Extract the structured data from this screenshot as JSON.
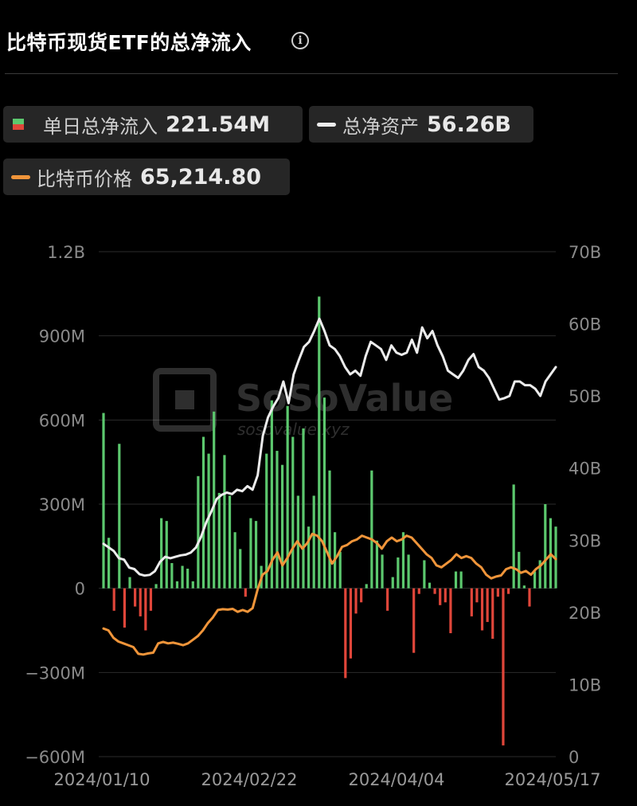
{
  "header": {
    "title": "比特币现货ETF的总净流入",
    "info_icon": "info-icon"
  },
  "legend": {
    "daily_inflow": {
      "label": "单日总净流入",
      "value": "221.54M",
      "pos_color": "#5cc86e",
      "neg_color": "#e0463a"
    },
    "total_assets": {
      "label": "总净资产",
      "value": "56.26B",
      "color": "#ececec"
    },
    "btc_price": {
      "label": "比特币价格",
      "value": "65,214.80",
      "color": "#f0953a"
    }
  },
  "watermark": {
    "brand": "SoSoValue",
    "url": "sosovalue.xyz"
  },
  "chart_data": {
    "type": "bar",
    "left_axis": {
      "ticks": [
        "1.2B",
        "900M",
        "600M",
        "300M",
        "0",
        "−300M",
        "−600M"
      ],
      "ylim": [
        -600,
        1200
      ],
      "unit": "M"
    },
    "right_axis": {
      "ticks": [
        "70B",
        "60B",
        "50B",
        "40B",
        "30B",
        "20B",
        "10B",
        "0"
      ],
      "ylim": [
        0,
        70
      ],
      "unit": "B"
    },
    "x_ticks": [
      "2024/01/10",
      "2024/02/22",
      "2024/04/04",
      "2024/05/17"
    ],
    "series": [
      {
        "name": "单日总净流入",
        "type": "bar",
        "values": [
          625,
          180,
          -80,
          515,
          -140,
          40,
          -65,
          -100,
          -150,
          -80,
          15,
          250,
          240,
          90,
          25,
          80,
          70,
          25,
          400,
          540,
          480,
          630,
          340,
          475,
          330,
          200,
          140,
          -30,
          250,
          240,
          80,
          480,
          670,
          490,
          440,
          650,
          540,
          330,
          570,
          220,
          330,
          1040,
          680,
          420,
          200,
          130,
          -320,
          -250,
          -90,
          -50,
          15,
          420,
          170,
          120,
          -80,
          40,
          110,
          200,
          120,
          -230,
          -20,
          100,
          20,
          -20,
          -60,
          -50,
          -160,
          60,
          60,
          0,
          -100,
          -50,
          -150,
          -120,
          -180,
          -30,
          -560,
          -20,
          370,
          130,
          10,
          -65,
          60,
          100,
          300,
          250,
          220
        ]
      },
      {
        "name": "总净资产",
        "type": "line",
        "values": [
          29.5,
          29.0,
          28.5,
          27.5,
          27.3,
          26.2,
          26.0,
          25.3,
          25.1,
          25.2,
          25.7,
          27.0,
          27.7,
          27.5,
          27.7,
          27.9,
          28.0,
          28.3,
          29.0,
          30.5,
          32.5,
          34.0,
          35.7,
          36.3,
          36.6,
          36.4,
          37.0,
          36.8,
          37.5,
          37.0,
          39.0,
          44.5,
          47.0,
          48.5,
          49.7,
          52.0,
          49.0,
          53.0,
          55.0,
          56.8,
          57.5,
          59.0,
          60.7,
          59.0,
          57.0,
          56.5,
          55.5,
          54.0,
          53.0,
          53.5,
          52.8,
          55.5,
          57.5,
          57.0,
          56.5,
          55.0,
          57.0,
          56.0,
          55.7,
          56.0,
          57.8,
          56.0,
          59.5,
          58.0,
          59.0,
          57.0,
          55.5,
          53.5,
          53.0,
          52.5,
          53.5,
          55.0,
          55.8,
          54.0,
          53.5,
          52.5,
          51.0,
          49.5,
          49.7,
          50.0,
          52.0,
          52.0,
          51.5,
          51.5,
          51.0,
          50.0,
          52.0,
          53.0,
          54.0
        ]
      },
      {
        "name": "比特币价格",
        "type": "line",
        "values": [
          46500,
          46000,
          44000,
          43000,
          42500,
          42000,
          41500,
          39700,
          39500,
          39800,
          40000,
          42500,
          42900,
          42500,
          42700,
          42400,
          42000,
          42500,
          43500,
          44500,
          46000,
          48000,
          49500,
          51500,
          51700,
          51600,
          51800,
          51000,
          51500,
          51000,
          52000,
          57000,
          61000,
          62000,
          65000,
          67000,
          63500,
          65500,
          68000,
          70000,
          68000,
          69500,
          72000,
          71500,
          70000,
          67000,
          64000,
          66000,
          68500,
          69000,
          70000,
          70500,
          71500,
          71000,
          70500,
          69500,
          68000,
          70000,
          71000,
          70000,
          70500,
          71500,
          71000,
          69500,
          68000,
          66500,
          65500,
          63500,
          63000,
          64000,
          65000,
          66500,
          65500,
          66000,
          65500,
          64000,
          63000,
          61000,
          60000,
          60500,
          60800,
          62500,
          63000,
          62500,
          61500,
          62000,
          61000,
          62500,
          63500,
          65000,
          66500,
          65200
        ]
      }
    ]
  }
}
